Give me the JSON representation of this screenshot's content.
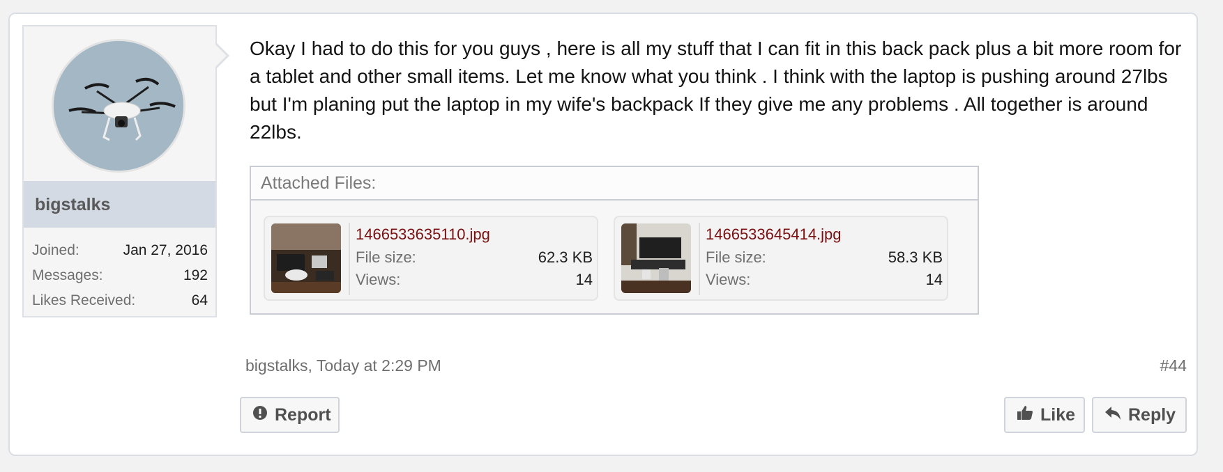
{
  "user": {
    "username": "bigstalks",
    "stats": [
      {
        "label": "Joined:",
        "value": "Jan 27, 2016"
      },
      {
        "label": "Messages:",
        "value": "192"
      },
      {
        "label": "Likes Received:",
        "value": "64"
      }
    ]
  },
  "message": {
    "text": "Okay I had to do this for you guys , here is all my stuff that I can fit in this back pack plus a bit more room for a tablet and other small items. Let me know what you think . I think with the laptop is pushing around 27lbs but I'm planing put the laptop in my wife's backpack If they give me any problems . All together is around 22lbs."
  },
  "attachments": {
    "header": "Attached Files:",
    "files": [
      {
        "name": "1466533635110.jpg",
        "size_label": "File size:",
        "size": "62.3 KB",
        "views_label": "Views:",
        "views": "14"
      },
      {
        "name": "1466533645414.jpg",
        "size_label": "File size:",
        "size": "58.3 KB",
        "views_label": "Views:",
        "views": "14"
      }
    ]
  },
  "meta": {
    "byline": "bigstalks, Today at 2:29 PM",
    "post_number": "#44"
  },
  "actions": {
    "report": "Report",
    "like": "Like",
    "reply": "Reply"
  },
  "icons": {
    "report": "exclamation-circle-icon",
    "like": "thumbs-up-icon",
    "reply": "reply-arrow-icon"
  }
}
